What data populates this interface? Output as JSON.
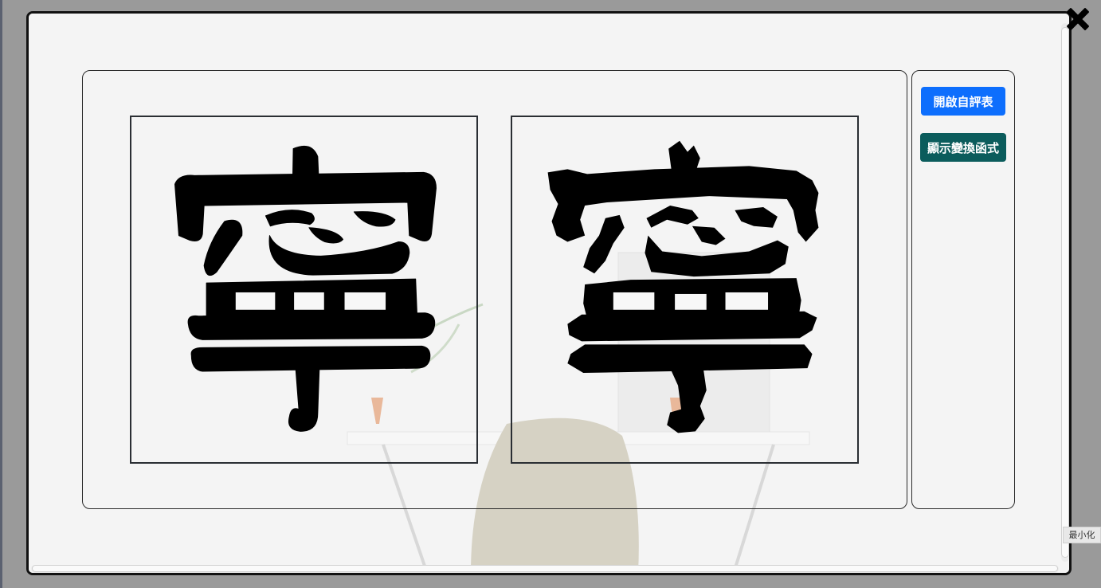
{
  "buttons": {
    "self_eval": "開啟自評表",
    "show_transform": "顯示變換函式"
  },
  "tooltip": "最小化",
  "icons": {
    "close": "close-icon"
  },
  "colors": {
    "primary_button": "#0d6efd",
    "teal_button": "#0b5c5c",
    "modal_border": "#111111"
  }
}
